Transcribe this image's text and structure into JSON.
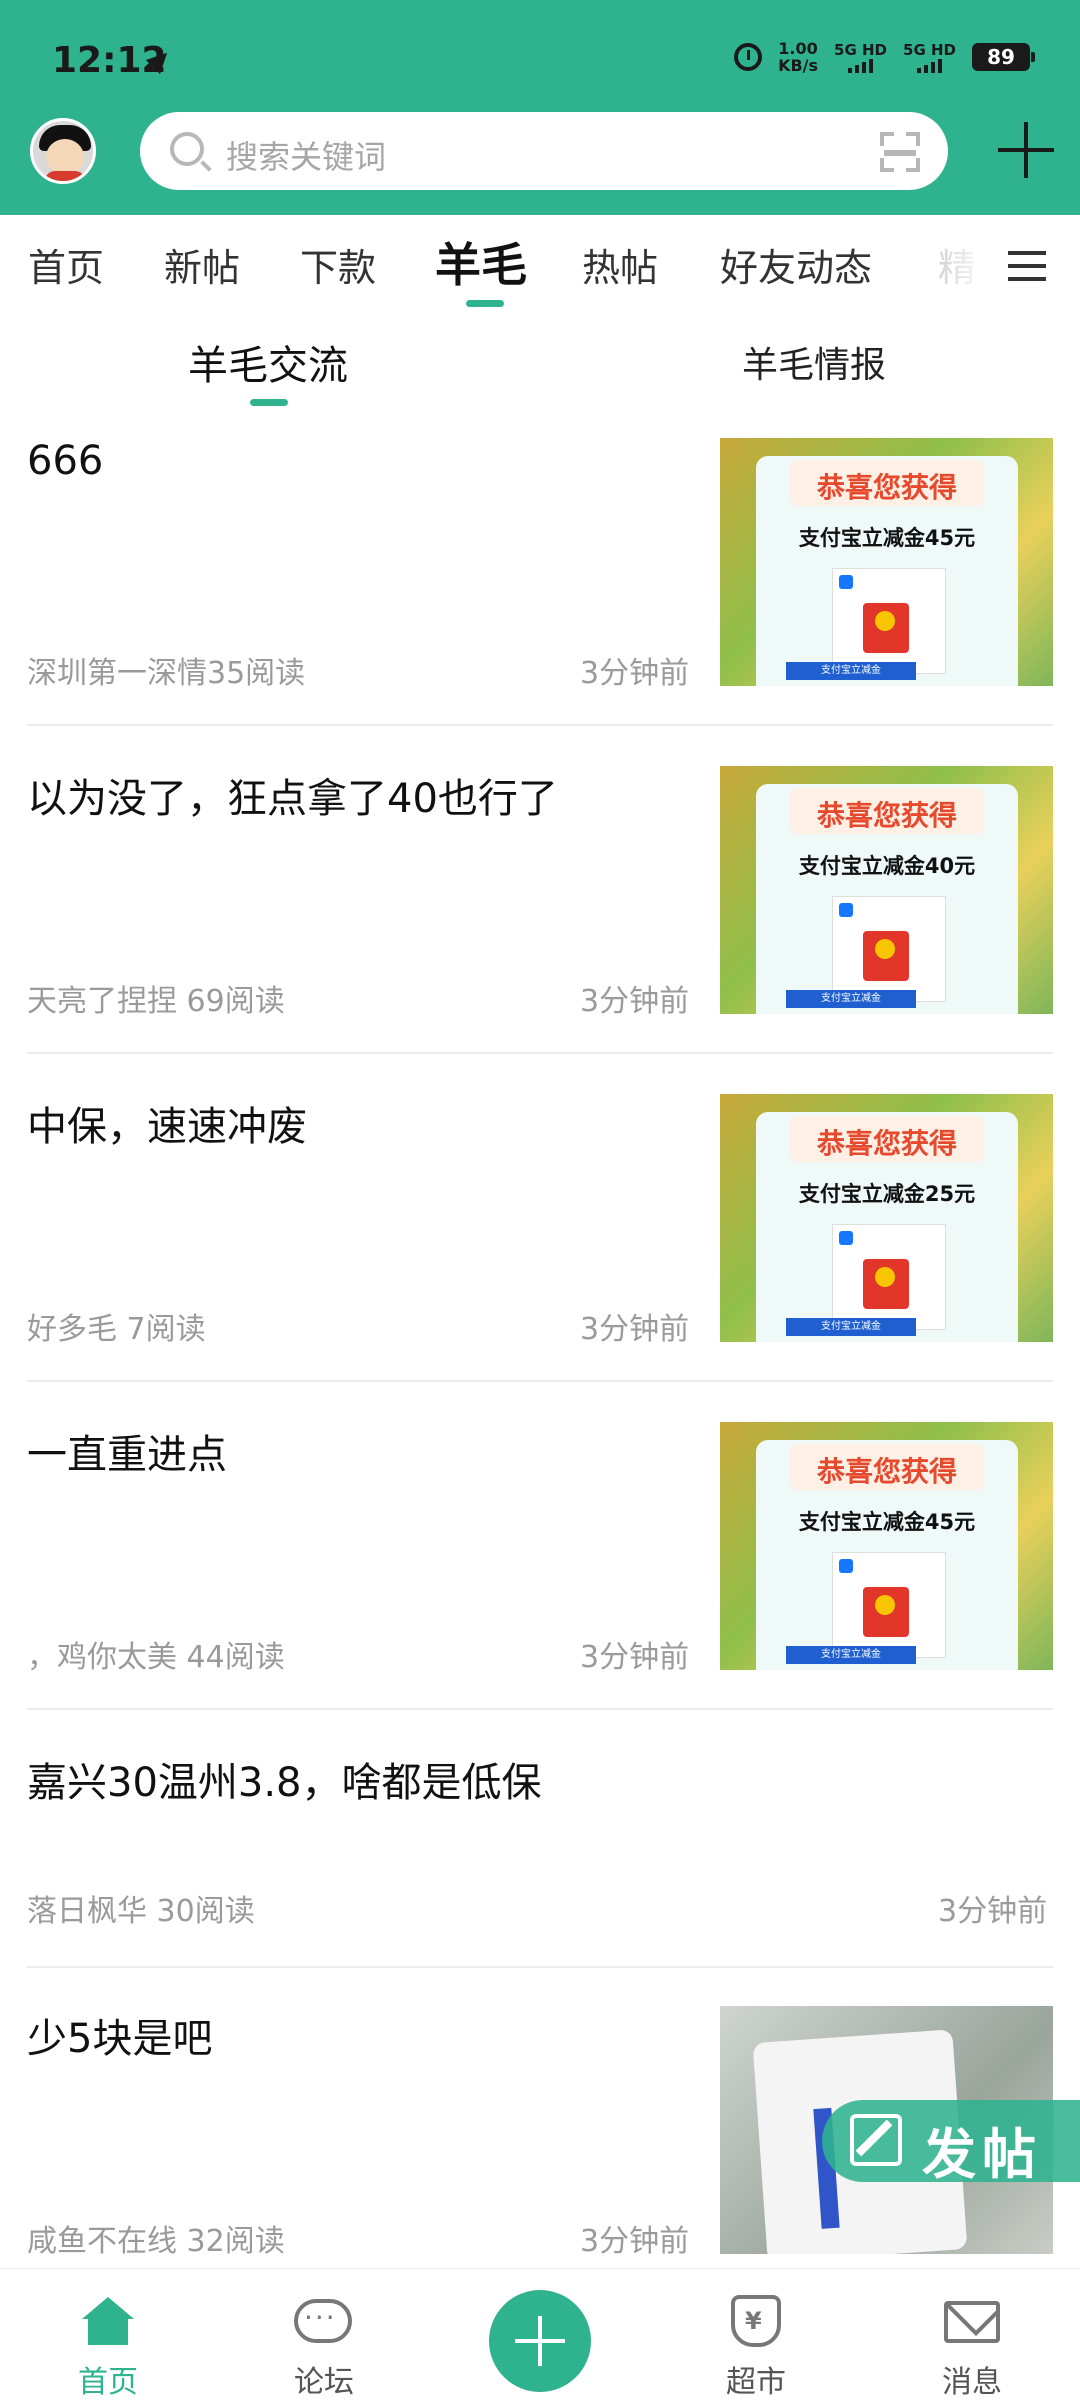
{
  "status_bar": {
    "time": "12:12",
    "net_speed_value": "1.00",
    "net_speed_unit": "KB/s",
    "sim1": "5G HD",
    "sim2": "5G HD",
    "battery": "89"
  },
  "header": {
    "search_placeholder": "搜索关键词"
  },
  "tabs": [
    {
      "label": "首页",
      "active": false
    },
    {
      "label": "新帖",
      "active": false
    },
    {
      "label": "下款",
      "active": false
    },
    {
      "label": "羊毛",
      "active": true
    },
    {
      "label": "热帖",
      "active": false
    },
    {
      "label": "好友动态",
      "active": false
    },
    {
      "label": "精",
      "active": false
    }
  ],
  "subtabs": [
    {
      "label": "羊毛交流",
      "active": true
    },
    {
      "label": "羊毛情报",
      "active": false
    }
  ],
  "posts": [
    {
      "title": "666",
      "meta": "深圳第一深情35阅读",
      "time": "3分钟前",
      "thumb": {
        "congrats": "恭喜您获得",
        "amount": "支付宝立减金45元",
        "button": "支付宝立减金"
      }
    },
    {
      "title": "以为没了，狂点拿了40也行了",
      "meta": "天亮了捏捏 69阅读",
      "time": "3分钟前",
      "thumb": {
        "congrats": "恭喜您获得",
        "amount": "支付宝立减金40元",
        "button": "支付宝立减金"
      }
    },
    {
      "title": "中保，速速冲废",
      "meta": "好多毛 7阅读",
      "time": "3分钟前",
      "thumb": {
        "congrats": "恭喜您获得",
        "amount": "支付宝立减金25元",
        "button": "支付宝立减金"
      }
    },
    {
      "title": "一直重进点",
      "meta": "，鸡你太美 44阅读",
      "time": "3分钟前",
      "thumb": {
        "congrats": "恭喜您获得",
        "amount": "支付宝立减金45元",
        "button": "支付宝立减金"
      }
    },
    {
      "title": "嘉兴30温州3.8，啥都是低保",
      "meta": "落日枫华 30阅读",
      "time": "3分钟前",
      "thumb": null
    },
    {
      "title": "少5块是吧",
      "meta": "咸鱼不在线 32阅读",
      "time": "3分钟前",
      "thumb": {
        "congrats": "",
        "amount": "",
        "button": ""
      }
    }
  ],
  "floating_button": {
    "label": "发帖"
  },
  "bottom_nav": [
    {
      "label": "首页",
      "icon": "home-icon",
      "active": true
    },
    {
      "label": "论坛",
      "icon": "chat-icon",
      "active": false
    },
    {
      "label": "",
      "icon": "plus-icon",
      "active": false
    },
    {
      "label": "超市",
      "icon": "bag-icon",
      "active": false
    },
    {
      "label": "消息",
      "icon": "mail-icon",
      "active": false
    }
  ],
  "colors": {
    "accent": "#2fb38f",
    "promo_red": "#e64a2e"
  }
}
